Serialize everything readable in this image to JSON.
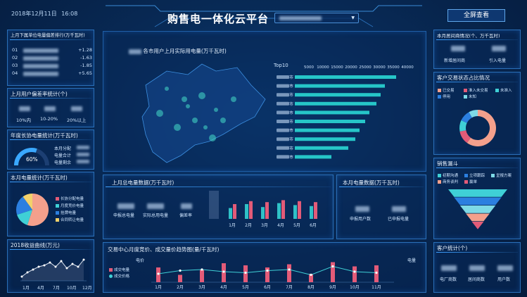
{
  "header": {
    "date": "2018年12月11日",
    "time": "16:08",
    "title": "购售电一体化云平台",
    "dropdown_arrow": "▼",
    "fullscreen": "全屏查看"
  },
  "left": {
    "rank_title": "上月下属单位电量偏差排行(万千瓦时)",
    "rank": [
      {
        "no": "01",
        "value": "+1.28"
      },
      {
        "no": "02",
        "value": "-1.63"
      },
      {
        "no": "03",
        "value": "-1.85"
      },
      {
        "no": "04",
        "value": "+5.65"
      }
    ],
    "dev_title": "上月用户偏差率统计(个)",
    "dev_labels": [
      "10%内",
      "10-20%",
      "20%以上"
    ],
    "annual_title": "年度长协电量统计(万千瓦时)",
    "gauge_pct": "60%",
    "gauge_value": 0.6,
    "annual_items": [
      "本月分配",
      "电量合计",
      "电量剩余"
    ],
    "month_title": "本月电量统计(万千瓦时)",
    "pie_legend": [
      {
        "label": "长协分配电量",
        "color": "#e35b78"
      },
      {
        "label": "月度竞价电量",
        "color": "#3fd0d6"
      },
      {
        "label": "挂牌电量",
        "color": "#2b7fe0"
      },
      {
        "label": "合同转让电量",
        "color": "#f2d16b"
      }
    ],
    "pie_values": [
      0.55,
      0.15,
      0.2,
      0.1
    ],
    "pie_colors": [
      "#f4a08c",
      "#3fd0d6",
      "#2b7fe0",
      "#f2d16b"
    ],
    "revenue_title": "2018收益曲线(万元)",
    "revenue_x": [
      "1月",
      "4月",
      "7月",
      "10月",
      "12月"
    ]
  },
  "center": {
    "map_title": "各市用户上月实际用电量(万千瓦时)",
    "top10_label": "Top10",
    "top10_ticks": [
      "5000",
      "10000",
      "15000",
      "20000",
      "25000",
      "30000",
      "35000",
      "40000"
    ],
    "top10_suffix": "市",
    "top10_values": [
      36000,
      32000,
      30500,
      29000,
      26500,
      25000,
      23000,
      21500,
      19000,
      13000
    ],
    "top10_max": 40000,
    "prev_title": "上月总电量数据(万千瓦时)",
    "prev_labels": [
      "申报总电量",
      "实际总用电量",
      "偏差率"
    ],
    "prev_months": [
      "1月",
      "2月",
      "3月",
      "4月",
      "5月",
      "6月"
    ],
    "prev_series_a": [
      0.55,
      0.75,
      0.6,
      0.8,
      0.7,
      0.65
    ],
    "prev_series_b": [
      0.75,
      0.9,
      0.85,
      0.95,
      0.9,
      0.85
    ],
    "month_title": "本月电量数据(万千瓦时)",
    "month_labels": [
      "申报用户数",
      "已申报电量"
    ],
    "trade_title": "交易中心月度竞价、成交量价趋势图(量/千瓦时)",
    "trade_left_axis": "电价",
    "trade_right_axis": "电量",
    "trade_legend": [
      "成交电量",
      "成交价格"
    ],
    "trade_months": [
      "1月",
      "2月",
      "3月",
      "4月",
      "5月",
      "6月",
      "7月",
      "8月",
      "9月",
      "10月",
      "11月"
    ],
    "trade_bars": [
      0.7,
      0.35,
      0.6,
      0.9,
      0.8,
      0.7,
      0.85,
      0.4,
      0.95,
      0.75,
      0.8
    ],
    "trade_line": [
      0.4,
      0.55,
      0.6,
      0.5,
      0.45,
      0.55,
      0.6,
      0.35,
      0.75,
      0.5,
      0.45
    ]
  },
  "right": {
    "service_title": "本月居间商情况(个、万千瓦时)",
    "service_labels": [
      "新增居间商",
      "引入电量"
    ],
    "status_title": "客户交易状态占比情况",
    "status_legend": [
      {
        "label": "已交易",
        "color": "#f4a08c"
      },
      {
        "label": "准入未交易",
        "color": "#e35b78"
      },
      {
        "label": "未准入",
        "color": "#3fd0d6"
      },
      {
        "label": "停用",
        "color": "#2b7fe0"
      },
      {
        "label": "未知",
        "color": "#7dd9e6"
      }
    ],
    "donut_values": [
      0.6,
      0.12,
      0.1,
      0.1,
      0.08
    ],
    "funnel_title": "销售漏斗",
    "funnel_legend": [
      {
        "label": "初期沟通",
        "color": "#3fd0d6"
      },
      {
        "label": "立项跟踪",
        "color": "#2b7fe0"
      },
      {
        "label": "呈报方案",
        "color": "#7dd9e6"
      },
      {
        "label": "商务谈判",
        "color": "#f4a08c"
      },
      {
        "label": "赢单",
        "color": "#e35b78"
      }
    ],
    "cust_title": "客户统计(个)",
    "cust_labels": [
      "电厂商数",
      "居间商数",
      "用户数"
    ]
  }
}
